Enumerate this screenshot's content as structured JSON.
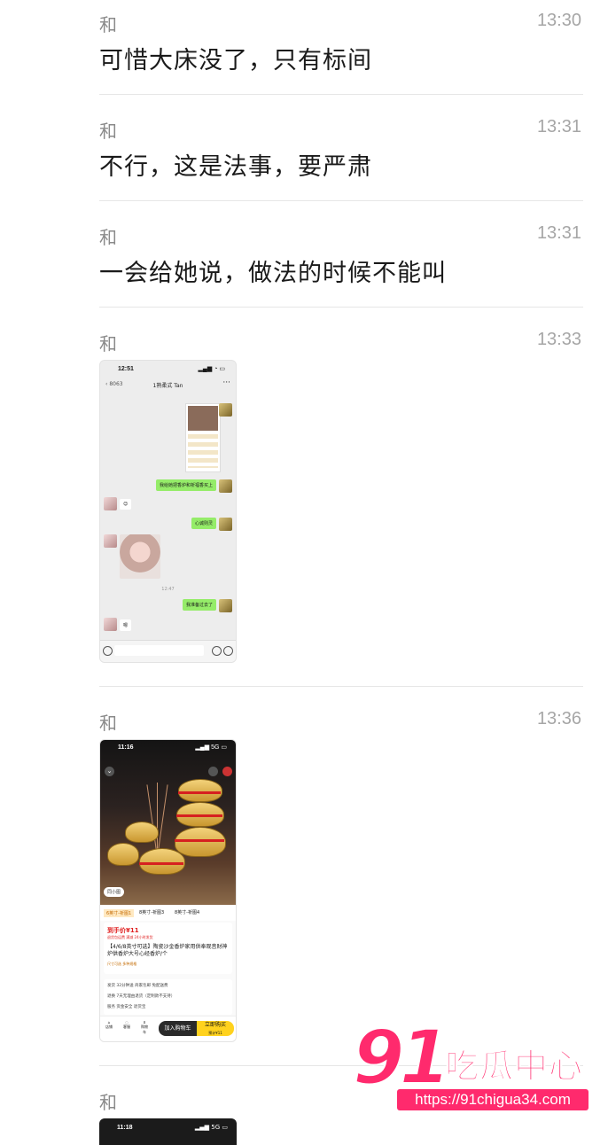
{
  "messages": [
    {
      "sender": "和",
      "time": "13:30",
      "text": "可惜大床没了，只有标间"
    },
    {
      "sender": "和",
      "time": "13:31",
      "text": "不行，这是法事，要严肃"
    },
    {
      "sender": "和",
      "time": "13:31",
      "text": "一会给她说，做法的时候不能叫"
    },
    {
      "sender": "和",
      "time": "13:33"
    },
    {
      "sender": "和",
      "time": "13:36"
    },
    {
      "sender": "和"
    }
  ],
  "shot1": {
    "clock": "12:51",
    "back_count": "8063",
    "title": "1熟柔式 Tan",
    "bubbles": [
      "我给她把香炉和祈福香买上",
      "心诚则灵",
      "我准备过去了"
    ],
    "reply": "嗯",
    "time_label": "12:47"
  },
  "shot2": {
    "clock": "11:16",
    "signal": "5G",
    "badge": "同小图",
    "tabs": [
      "6英寸-祈图1",
      "8英寸-祈图3",
      "8英寸-祈图4"
    ],
    "price": "到手价¥11",
    "tags": "退货包运费  满减  24小时发货",
    "title": "【4/6/8英寸可选】陶瓷沙金香炉家用供奉观音财神炉供香炉大号心经香炉/个",
    "tip": "尺寸可选  多种规格",
    "services": [
      "发货 32分钟送  商家包邮  免配送费",
      "退换 7天无理由退货（定制款不支持）",
      "服务 资金安全  退货宝"
    ],
    "bottom_icons": [
      "店铺",
      "客服",
      "购物车"
    ],
    "cart": "加入购物车",
    "buy": "立即购买",
    "buy_sub": "预计¥11"
  },
  "shot3": {
    "clock": "11:18",
    "signal": "5G"
  },
  "watermark": {
    "number": "91",
    "name": "吃瓜中心",
    "url": "https://91chigua34.com"
  }
}
